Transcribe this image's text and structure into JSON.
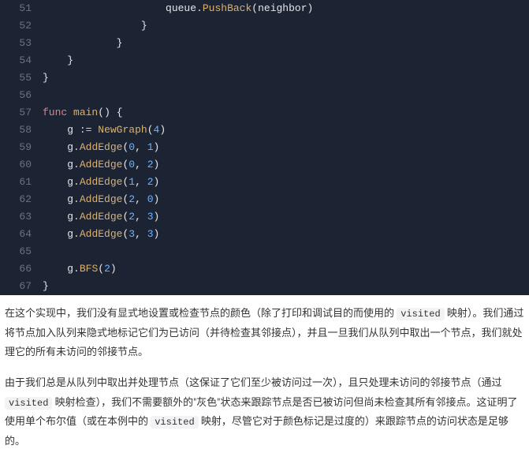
{
  "code": {
    "lines": [
      {
        "no": 51,
        "indent": "                    ",
        "tokens": [
          "id:queue",
          "dot:.",
          "fn:PushBack",
          "pn:(",
          "id:neighbor",
          "pn:)"
        ]
      },
      {
        "no": 52,
        "indent": "                ",
        "tokens": [
          "pn:}"
        ]
      },
      {
        "no": 53,
        "indent": "            ",
        "tokens": [
          "pn:}"
        ]
      },
      {
        "no": 54,
        "indent": "    ",
        "tokens": [
          "pn:}"
        ]
      },
      {
        "no": 55,
        "indent": "",
        "tokens": [
          "pn:}"
        ]
      },
      {
        "no": 56,
        "indent": "",
        "tokens": []
      },
      {
        "no": 57,
        "indent": "",
        "tokens": [
          "kw:func",
          "sp: ",
          "fn:main",
          "pn:(",
          "pn:)",
          "sp: ",
          "pn:{"
        ]
      },
      {
        "no": 58,
        "indent": "    ",
        "tokens": [
          "id:g",
          "sp: ",
          "op::=",
          "sp: ",
          "fn:NewGraph",
          "pn:(",
          "num:4",
          "pn:)"
        ]
      },
      {
        "no": 59,
        "indent": "    ",
        "tokens": [
          "id:g",
          "dot:.",
          "fn:AddEdge",
          "pn:(",
          "num:0",
          "pn:,",
          "sp: ",
          "num:1",
          "pn:)"
        ]
      },
      {
        "no": 60,
        "indent": "    ",
        "tokens": [
          "id:g",
          "dot:.",
          "fn:AddEdge",
          "pn:(",
          "num:0",
          "pn:,",
          "sp: ",
          "num:2",
          "pn:)"
        ]
      },
      {
        "no": 61,
        "indent": "    ",
        "tokens": [
          "id:g",
          "dot:.",
          "fn:AddEdge",
          "pn:(",
          "num:1",
          "pn:,",
          "sp: ",
          "num:2",
          "pn:)"
        ]
      },
      {
        "no": 62,
        "indent": "    ",
        "tokens": [
          "id:g",
          "dot:.",
          "fn:AddEdge",
          "pn:(",
          "num:2",
          "pn:,",
          "sp: ",
          "num:0",
          "pn:)"
        ]
      },
      {
        "no": 63,
        "indent": "    ",
        "tokens": [
          "id:g",
          "dot:.",
          "fn:AddEdge",
          "pn:(",
          "num:2",
          "pn:,",
          "sp: ",
          "num:3",
          "pn:)"
        ]
      },
      {
        "no": 64,
        "indent": "    ",
        "tokens": [
          "id:g",
          "dot:.",
          "fn:AddEdge",
          "pn:(",
          "num:3",
          "pn:,",
          "sp: ",
          "num:3",
          "pn:)"
        ]
      },
      {
        "no": 65,
        "indent": "",
        "tokens": []
      },
      {
        "no": 66,
        "indent": "    ",
        "tokens": [
          "id:g",
          "dot:.",
          "fn:BFS",
          "pn:(",
          "num:2",
          "pn:)"
        ]
      },
      {
        "no": 67,
        "indent": "",
        "tokens": [
          "pn:}"
        ]
      }
    ]
  },
  "prose": {
    "p1a": "在这个实现中，我们没有显式地设置或检查节点的颜色（除了打印和调试目的而使用的 ",
    "p1code1": "visited",
    "p1b": " 映射）。我们通过将节点加入队列来隐式地标记它们为已访问（并待检查其邻接点），并且一旦我们从队列中取出一个节点，我们就处理它的所有未访问的邻接节点。",
    "p2a": "由于我们总是从队列中取出并处理节点（这保证了它们至少被访问过一次），且只处理未访问的邻接节点（通过 ",
    "p2code1": "visited",
    "p2b": " 映射检查），我们不需要额外的\"灰色\"状态来跟踪节点是否已被访问但尚未检查其所有邻接点。这证明了使用单个布尔值（或在本例中的 ",
    "p2code2": "visited",
    "p2c": " 映射，尽管它对于颜色标记是过度的）来跟踪节点的访问状态是足够的。"
  }
}
